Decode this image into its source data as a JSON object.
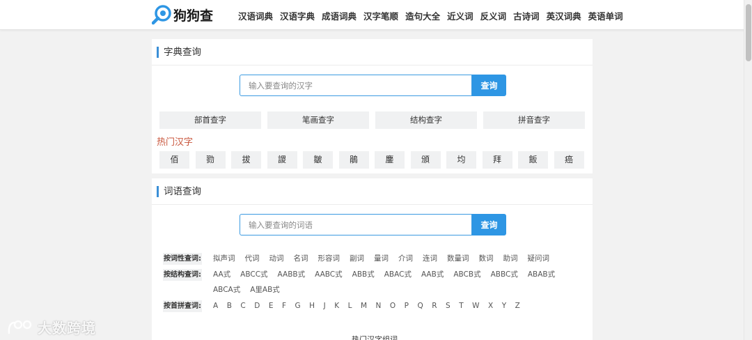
{
  "site": {
    "name": "狗狗查",
    "brand_color": "#2e96e4"
  },
  "nav": [
    "汉语词典",
    "汉语字典",
    "成语词典",
    "汉字笔顺",
    "造句大全",
    "近义词",
    "反义词",
    "古诗词",
    "英汉词典",
    "英语单词"
  ],
  "zidian": {
    "title": "字典查询",
    "placeholder": "输入要查询的汉字",
    "button": "查询",
    "modes": [
      "部首查字",
      "笔画查字",
      "结构查字",
      "拼音查字"
    ],
    "hot_title": "热门汉字",
    "hot_chars": [
      "佰",
      "勠",
      "拔",
      "謖",
      "皺",
      "鵑",
      "鏖",
      "頒",
      "均",
      "拜",
      "飯",
      "癌"
    ]
  },
  "ciyu": {
    "title": "词语查询",
    "placeholder": "输入要查询的词语",
    "button": "查询",
    "pos_label": "按词性查词:",
    "pos_items": [
      "拟声词",
      "代词",
      "动词",
      "名词",
      "形容词",
      "副词",
      "量词",
      "介词",
      "连词",
      "数量词",
      "数词",
      "助词",
      "疑问词"
    ],
    "struct_label": "按结构查词:",
    "struct_items": [
      "AA式",
      "ABCC式",
      "AABB式",
      "AABC式",
      "ABB式",
      "ABAC式",
      "AAB式",
      "ABCB式",
      "ABBC式",
      "ABAB式",
      "ABCA式",
      "A里AB式"
    ],
    "pinyin_label": "按首拼查词:",
    "pinyin_items": [
      "A",
      "B",
      "C",
      "D",
      "E",
      "F",
      "G",
      "H",
      "J",
      "K",
      "L",
      "M",
      "N",
      "O",
      "P",
      "Q",
      "R",
      "S",
      "T",
      "W",
      "X",
      "Y",
      "Z"
    ],
    "hot_words_title": "热门汉字组词"
  },
  "watermark": "大数跨境"
}
